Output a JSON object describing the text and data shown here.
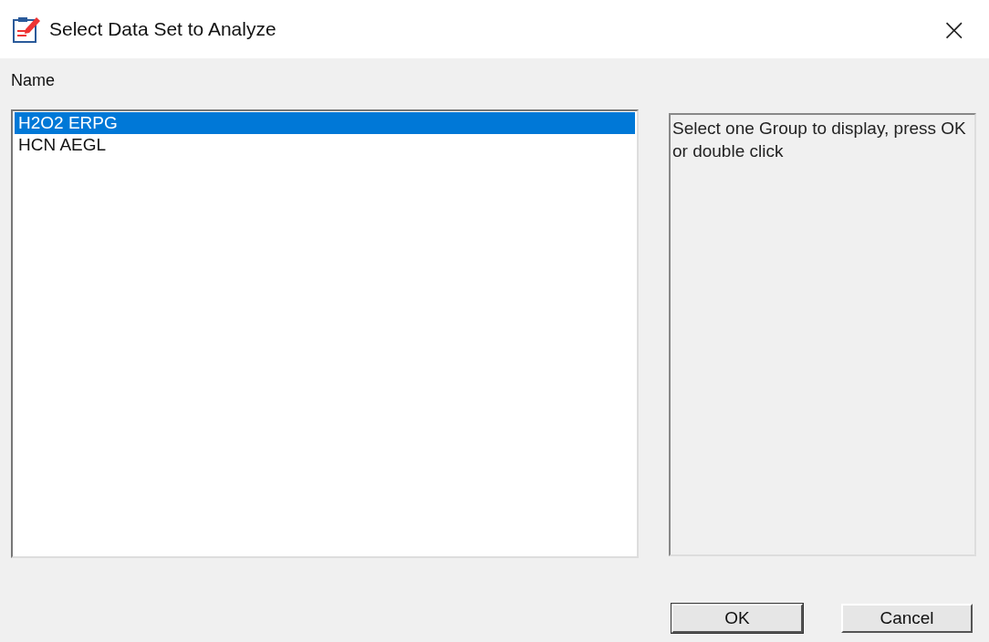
{
  "window": {
    "title": "Select Data Set to Analyze",
    "close": "×"
  },
  "list": {
    "label": "Name",
    "items": [
      {
        "label": "H2O2 ERPG",
        "selected": true
      },
      {
        "label": "HCN AEGL",
        "selected": false
      }
    ]
  },
  "info": "Select one Group to display, press OK or double click",
  "buttons": [
    "OK",
    "Cancel"
  ]
}
